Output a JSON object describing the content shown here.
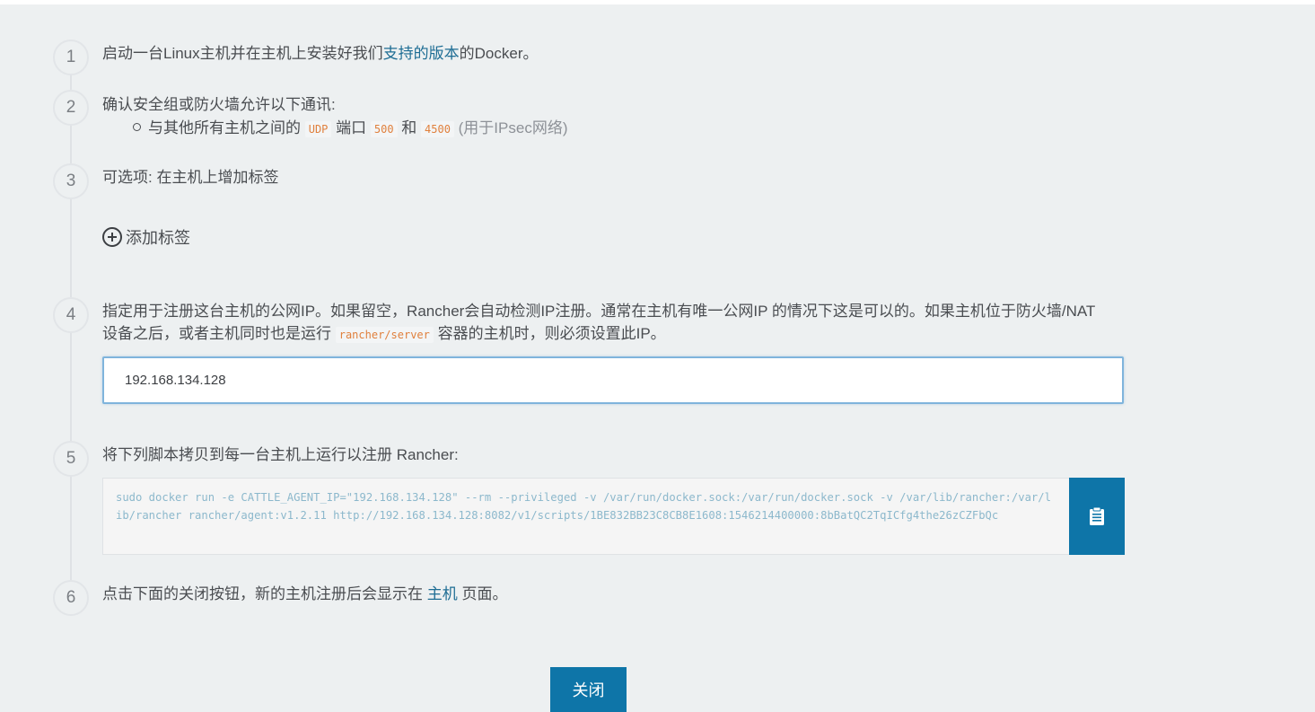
{
  "steps": [
    {
      "num": "1",
      "prefix": "启动一台Linux主机并在主机上安装好我们",
      "link": "支持的版本",
      "suffix": "的Docker。"
    },
    {
      "num": "2",
      "text": "确认安全组或防火墙允许以下通讯:"
    },
    {
      "num": "3",
      "text": "可选项: 在主机上增加标签"
    },
    {
      "num": "4",
      "line1": "指定用于注册这台主机的公网IP。如果留空，Rancher会自动检测IP注册。通常在主机有唯一公网IP 的情况下这是可以的。如果主机位于防火墙/NAT",
      "line2_prefix": "设备之后，或者主机同时也是运行 ",
      "line2_code": "rancher/server",
      "line2_suffix": " 容器的主机时，则必须设置此IP。"
    },
    {
      "num": "5",
      "text": "将下列脚本拷贝到每一台主机上运行以注册 Rancher:"
    },
    {
      "num": "6",
      "prefix": "点击下面的关闭按钮，新的主机注册后会显示在 ",
      "link": "主机",
      "suffix": " 页面。"
    }
  ],
  "firewall_rule": {
    "text1": "与其他所有主机之间的 ",
    "protocol": "UDP",
    "text2": " 端口 ",
    "port1": "500",
    "text3": " 和 ",
    "port2": "4500",
    "note": " (用于IPsec网络)"
  },
  "add_label": "添加标签",
  "ip_input": {
    "value": "192.168.134.128"
  },
  "script": "sudo docker run -e CATTLE_AGENT_IP=\"192.168.134.128\"  --rm --privileged -v /var/run/docker.sock:/var/run/docker.sock -v /var/lib/rancher:/var/lib/rancher rancher/agent:v1.2.11 http://192.168.134.128:8082/v1/scripts/1BE832BB23C8CB8E1608:1546214400000:8bBatQC2TqICfg4the26zCZFbQc",
  "copy_icon": "clipboard-icon",
  "close_button": "关闭",
  "colors": {
    "accent": "#0e75a8",
    "link": "#1e6d94",
    "code": "#e0803d",
    "background": "#edf0f1"
  }
}
